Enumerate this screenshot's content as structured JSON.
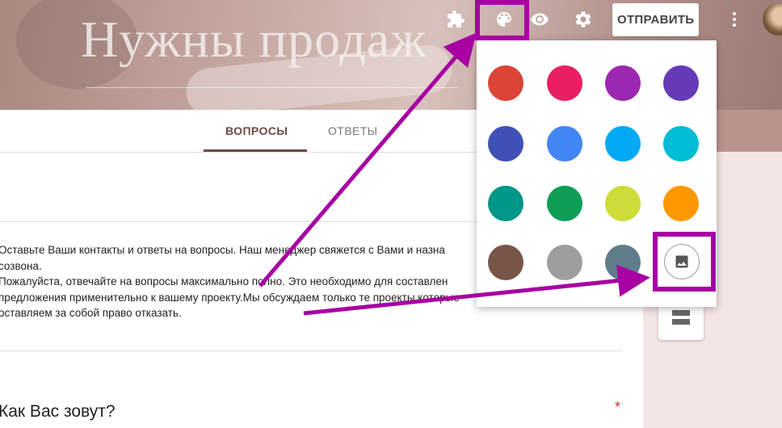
{
  "header": {
    "form_title": "Нужны продаж",
    "send_label": "ОТПРАВИТЬ",
    "icons": [
      "puzzle-icon",
      "palette-icon",
      "eye-icon",
      "gear-icon",
      "more-vert-icon"
    ]
  },
  "tabs": {
    "questions": "ВОПРОСЫ",
    "answers": "ОТВЕТЫ"
  },
  "description": [
    "Оставьте Ваши контакты и ответы на вопросы. Наш менеджер свяжется с Вами и назна",
    "созвона.",
    "Пожалуйста, отвечайте на вопросы максимально полно. Это необходимо для составлен",
    "предложения применительно к вашему проекту.Мы обсуждаем только те проекты,которые",
    "оставляем за собой право отказать."
  ],
  "question": {
    "title": "Как Вас зовут?",
    "required_mark": "*"
  },
  "theme_colors": [
    "#db4437",
    "#e91e63",
    "#9c27b0",
    "#673ab7",
    "#3f51b5",
    "#4285f4",
    "#03a9f4",
    "#00bcd4",
    "#009688",
    "#0f9d58",
    "#cddc39",
    "#ff9800",
    "#795548",
    "#9e9e9e",
    "#607d8b"
  ],
  "colors": {
    "accent": "#6e4a45",
    "highlight": "#a800a3"
  }
}
